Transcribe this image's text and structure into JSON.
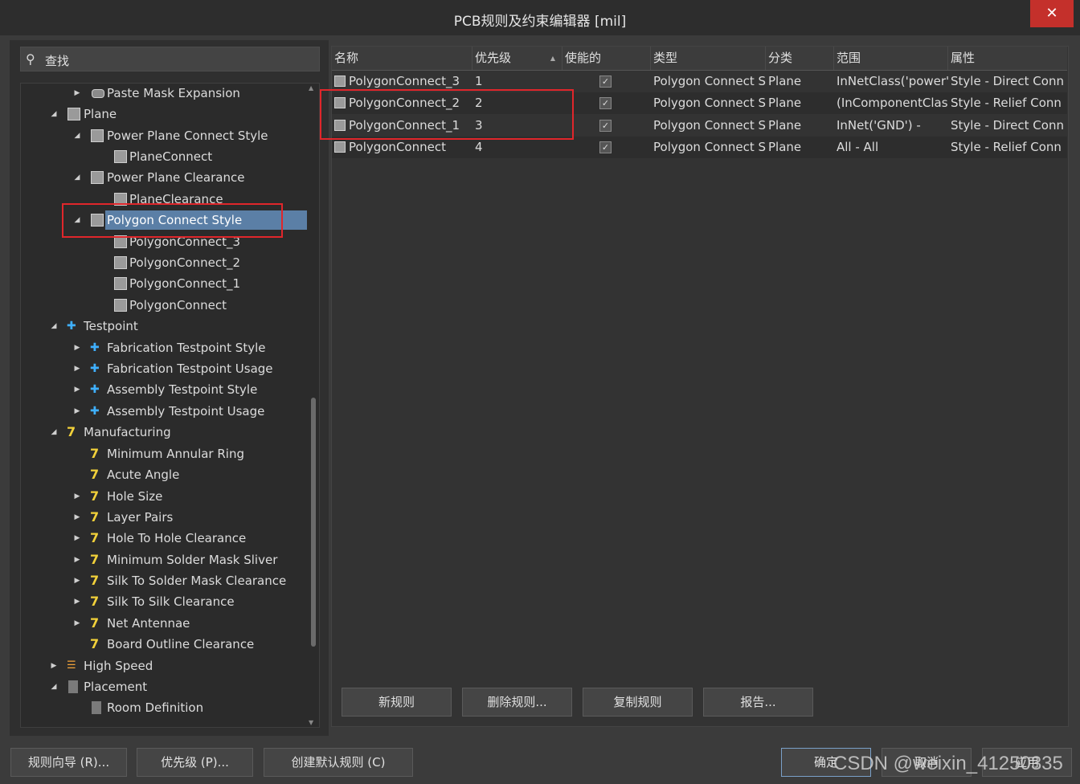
{
  "window": {
    "title": "PCB规则及约束编辑器 [mil]",
    "close_label": "✕"
  },
  "search": {
    "placeholder": "查找"
  },
  "tree": {
    "items": [
      {
        "label": "Paste Mask Expansion"
      },
      {
        "label": "Plane"
      },
      {
        "label": "Power Plane Connect Style"
      },
      {
        "label": "PlaneConnect"
      },
      {
        "label": "Power Plane Clearance"
      },
      {
        "label": "PlaneClearance"
      },
      {
        "label": "Polygon Connect Style"
      },
      {
        "label": "PolygonConnect_3"
      },
      {
        "label": "PolygonConnect_2"
      },
      {
        "label": "PolygonConnect_1"
      },
      {
        "label": "PolygonConnect"
      },
      {
        "label": "Testpoint"
      },
      {
        "label": "Fabrication Testpoint Style"
      },
      {
        "label": "Fabrication Testpoint Usage"
      },
      {
        "label": "Assembly Testpoint Style"
      },
      {
        "label": "Assembly Testpoint Usage"
      },
      {
        "label": "Manufacturing"
      },
      {
        "label": "Minimum Annular Ring"
      },
      {
        "label": "Acute Angle"
      },
      {
        "label": "Hole Size"
      },
      {
        "label": "Layer Pairs"
      },
      {
        "label": "Hole To Hole Clearance"
      },
      {
        "label": "Minimum Solder Mask Sliver"
      },
      {
        "label": "Silk To Solder Mask Clearance"
      },
      {
        "label": "Silk To Silk Clearance"
      },
      {
        "label": "Net Antennae"
      },
      {
        "label": "Board Outline Clearance"
      },
      {
        "label": "High Speed"
      },
      {
        "label": "Placement"
      },
      {
        "label": "Room Definition"
      }
    ],
    "selected": "Polygon Connect Style"
  },
  "grid": {
    "columns": [
      "名称",
      "优先级",
      "使能的",
      "类型",
      "分类",
      "范围",
      "属性"
    ],
    "rows": [
      {
        "name": "PolygonConnect_3",
        "priority": "1",
        "enabled": "✓",
        "type": "Polygon Connect S",
        "category": "Plane",
        "scope": "InNetClass('power'",
        "attributes": "Style - Direct Conn"
      },
      {
        "name": "PolygonConnect_2",
        "priority": "2",
        "enabled": "✓",
        "type": "Polygon Connect S",
        "category": "Plane",
        "scope": "(InComponentClas",
        "attributes": "Style - Relief Conn"
      },
      {
        "name": "PolygonConnect_1",
        "priority": "3",
        "enabled": "✓",
        "type": "Polygon Connect S",
        "category": "Plane",
        "scope": "InNet('GND')    -",
        "attributes": "Style - Direct Conn"
      },
      {
        "name": "PolygonConnect",
        "priority": "4",
        "enabled": "✓",
        "type": "Polygon Connect S",
        "category": "Plane",
        "scope": "All    -    All",
        "attributes": "Style - Relief Conn"
      }
    ]
  },
  "actions": {
    "new_rule": "新规则",
    "delete_rule": "删除规则...",
    "copy_rule": "复制规则",
    "report": "报告..."
  },
  "footer": {
    "wizard": "规则向导 (R)...",
    "priority": "优先级 (P)...",
    "create_default": "创建默认规则 (C)",
    "ok": "确定",
    "cancel": "取消",
    "apply": "应用"
  },
  "watermark": "CSDN @weixin_41250335",
  "colors": {
    "selection": "#5b7fa6",
    "highlight_box": "#e0262b",
    "close": "#c4302b"
  }
}
